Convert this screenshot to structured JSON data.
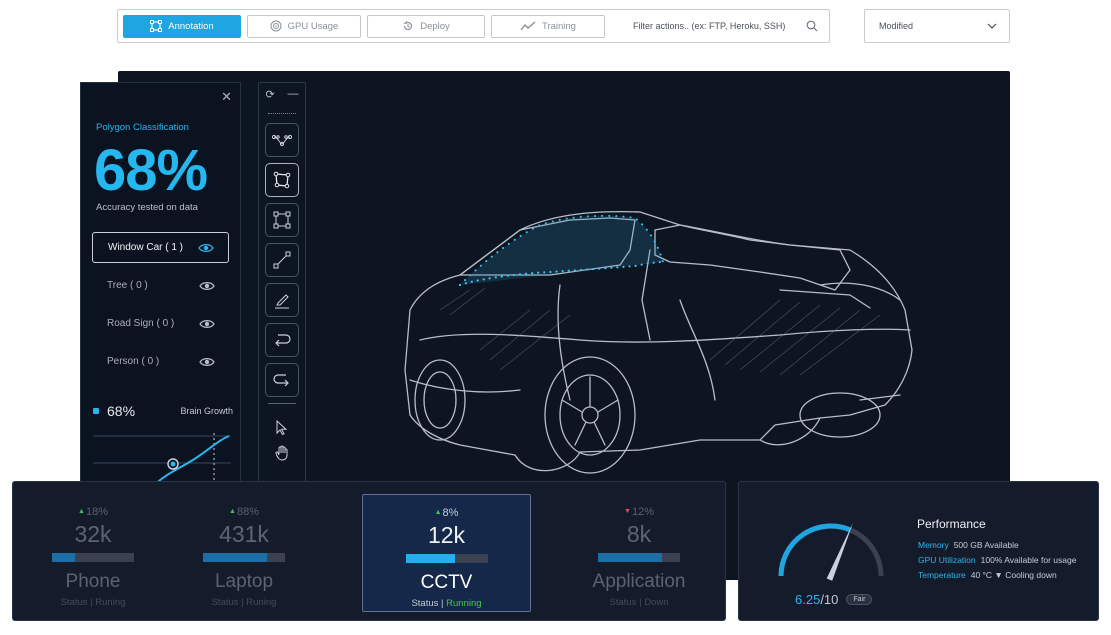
{
  "toolbar": {
    "buttons": [
      {
        "label": "Annotation",
        "icon": "annotation-icon"
      },
      {
        "label": "GPU Usage",
        "icon": "gpu-icon"
      },
      {
        "label": "Deploy",
        "icon": "deploy-icon"
      },
      {
        "label": "Training",
        "icon": "trend-icon"
      }
    ],
    "filter_placeholder": "Filter actions.. (ex: FTP, Heroku, SSH)",
    "sort_value": "Modified"
  },
  "left_panel": {
    "subtitle": "Polygon Classification",
    "accuracy": "68%",
    "caption": "Accuracy tested on data",
    "items": [
      {
        "label": "Window Car ( 1 )"
      },
      {
        "label": "Tree ( 0 )"
      },
      {
        "label": "Road Sign ( 0 )"
      },
      {
        "label": "Person ( 0 )"
      }
    ],
    "growth_value": "68%",
    "growth_label": "Brain Growth"
  },
  "tools": [
    "refresh-icon",
    "minimize-icon",
    "bezier-tool-icon",
    "polygon-tool-icon",
    "bounding-box-tool-icon",
    "line-tool-icon",
    "edit-tool-icon",
    "undo-icon",
    "redo-icon",
    "pointer-icon",
    "hand-icon"
  ],
  "stats": [
    {
      "change": "18%",
      "direction": "up",
      "value": "32k",
      "name": "Phone",
      "status_prefix": "Status",
      "status": "Runing",
      "progress": 0.28
    },
    {
      "change": "88%",
      "direction": "up",
      "value": "431k",
      "name": "Laptop",
      "status_prefix": "Status",
      "status": "Runing",
      "progress": 0.78
    },
    {
      "change": "8%",
      "direction": "up",
      "value": "12k",
      "name": "CCTV",
      "status_prefix": "Status",
      "status": "Running",
      "progress": 0.6
    },
    {
      "change": "12%",
      "direction": "down",
      "value": "8k",
      "name": "Application",
      "status_prefix": "Status",
      "status": "Down",
      "progress": 0.78
    }
  ],
  "performance": {
    "score": "6.25",
    "score_max": "/10",
    "rating": "Fair",
    "gauge_fraction": 0.625,
    "title": "Performance",
    "rows": [
      {
        "key": "Memory",
        "value": "500 GB  Available"
      },
      {
        "key": "GPU Utilization",
        "value": "100% Available for usage"
      },
      {
        "key": "Temperature",
        "value": "40 °C  ▼ Cooling down"
      }
    ]
  },
  "colors": {
    "accent": "#25b8f0",
    "highlight_bg": "#16284a",
    "up": "#3ec94a",
    "down": "#d9534f"
  }
}
